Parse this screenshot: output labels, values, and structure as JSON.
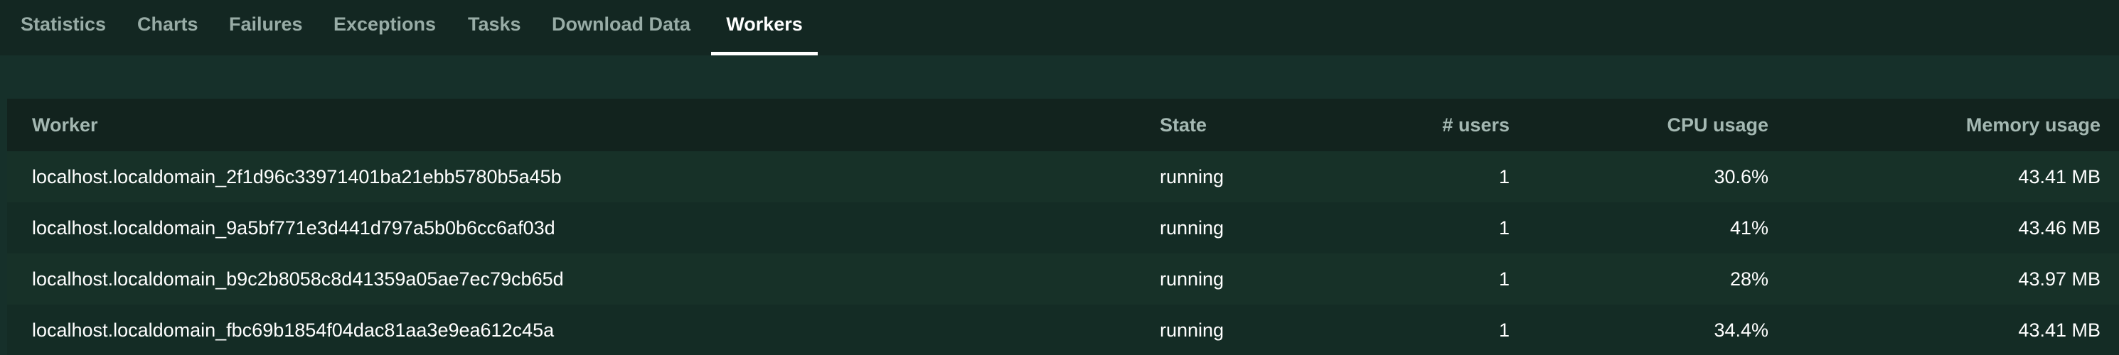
{
  "tabs": [
    {
      "label": "Statistics",
      "active": false
    },
    {
      "label": "Charts",
      "active": false
    },
    {
      "label": "Failures",
      "active": false
    },
    {
      "label": "Exceptions",
      "active": false
    },
    {
      "label": "Tasks",
      "active": false
    },
    {
      "label": "Download Data",
      "active": false
    },
    {
      "label": "Workers",
      "active": true
    }
  ],
  "workers_table": {
    "columns": [
      "Worker",
      "State",
      "# users",
      "CPU usage",
      "Memory usage"
    ],
    "rows": [
      {
        "worker": "localhost.localdomain_2f1d96c33971401ba21ebb5780b5a45b",
        "state": "running",
        "users": "1",
        "cpu": "30.6%",
        "memory": "43.41 MB"
      },
      {
        "worker": "localhost.localdomain_9a5bf771e3d441d797a5b0b6cc6af03d",
        "state": "running",
        "users": "1",
        "cpu": "41%",
        "memory": "43.46 MB"
      },
      {
        "worker": "localhost.localdomain_b9c2b8058c8d41359a05ae7ec79cb65d",
        "state": "running",
        "users": "1",
        "cpu": "28%",
        "memory": "43.97 MB"
      },
      {
        "worker": "localhost.localdomain_fbc69b1854f04dac81aa3e9ea612c45a",
        "state": "running",
        "users": "1",
        "cpu": "34.4%",
        "memory": "43.41 MB"
      }
    ]
  },
  "colors": {
    "page_background": "#16302a",
    "tabbar_background": "#132722",
    "header_background": "#12231e",
    "active_tab_text": "#ffffff",
    "inactive_tab_text": "#98aca6",
    "header_text": "#a4b8b2",
    "cell_text": "#ffffff"
  }
}
